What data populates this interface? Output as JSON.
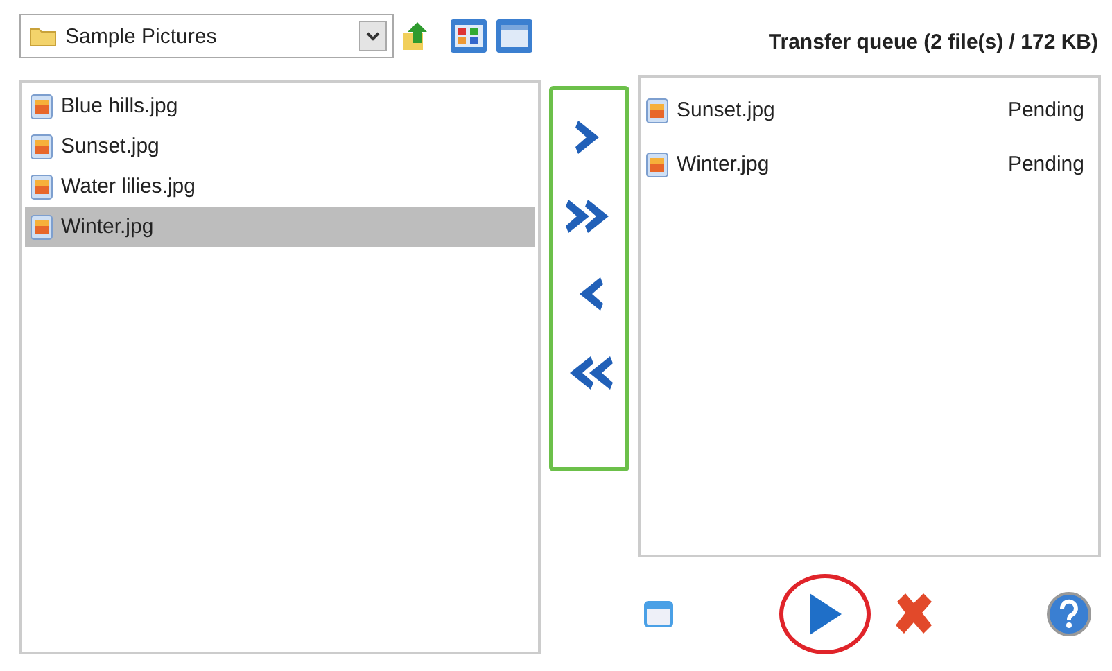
{
  "folder_select": {
    "value": "Sample Pictures"
  },
  "files": [
    {
      "name": "Blue hills.jpg",
      "selected": false
    },
    {
      "name": "Sunset.jpg",
      "selected": false
    },
    {
      "name": "Water lilies.jpg",
      "selected": false
    },
    {
      "name": "Winter.jpg",
      "selected": true
    }
  ],
  "queue": {
    "title": "Transfer queue (2 file(s) / 172 KB)",
    "items": [
      {
        "name": "Sunset.jpg",
        "status": "Pending"
      },
      {
        "name": "Winter.jpg",
        "status": "Pending"
      }
    ]
  }
}
